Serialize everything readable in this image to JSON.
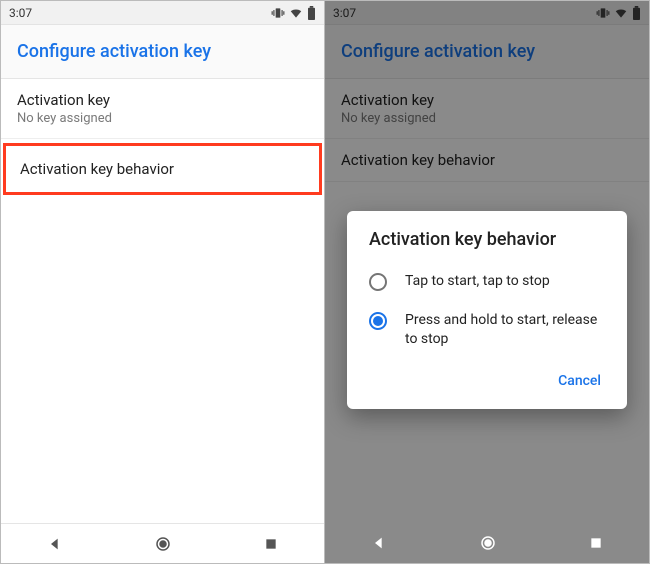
{
  "statusbar": {
    "time": "3:07"
  },
  "header": {
    "title": "Configure activation key"
  },
  "rows": {
    "activation_key": {
      "title": "Activation key",
      "sub": "No key assigned"
    },
    "behavior": {
      "title": "Activation key behavior"
    }
  },
  "dialog": {
    "title": "Activation key behavior",
    "options": [
      {
        "label": "Tap to start, tap to stop",
        "selected": false
      },
      {
        "label": "Press and hold to start, release to stop",
        "selected": true
      }
    ],
    "cancel": "Cancel"
  }
}
